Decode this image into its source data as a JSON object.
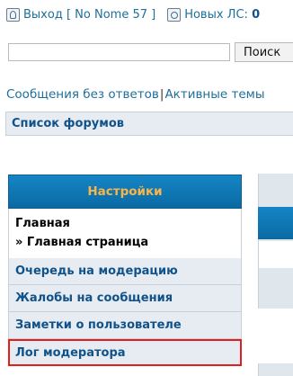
{
  "topbar": {
    "logout_label": "Выход",
    "username": "[ No Nome 57 ]",
    "pm_label": "Новых ЛС:",
    "pm_count": "0"
  },
  "search": {
    "value": "",
    "button_label": "Поиск"
  },
  "quicklinks": {
    "unanswered": "Сообщения без ответов",
    "separator": "|",
    "active": "Активные темы"
  },
  "forumbar": {
    "label": "Список форумов"
  },
  "sidemenu": {
    "header": "Настройки",
    "main_label": "Главная",
    "main_sub": "» Главная страница",
    "items": [
      {
        "label": "Очередь на модерацию"
      },
      {
        "label": "Жалобы на сообщения"
      },
      {
        "label": "Заметки о пользователе"
      },
      {
        "label": "Лог модератора"
      }
    ]
  },
  "colors": {
    "link": "#1f6f98",
    "header_bg": "#0b75b3",
    "header_text": "#f7b54a",
    "highlight_border": "#e02020"
  }
}
